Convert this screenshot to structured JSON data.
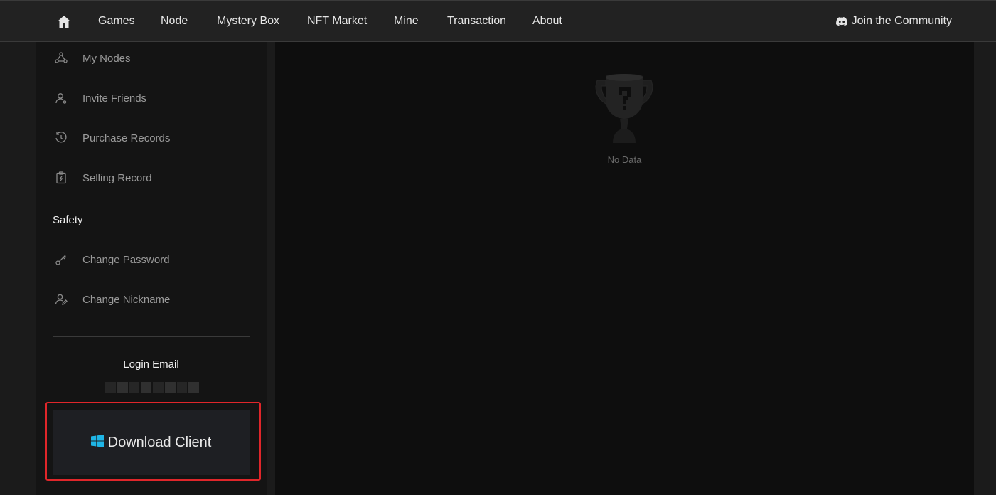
{
  "nav": {
    "items": [
      "Games",
      "Node",
      "Mystery Box",
      "NFT Market",
      "Mine",
      "Transaction",
      "About"
    ],
    "community": "Join the Community"
  },
  "sidebar": {
    "menu_top": [
      {
        "label": "My Nodes",
        "icon": "nodes-icon"
      },
      {
        "label": "Invite Friends",
        "icon": "invite-user-icon"
      },
      {
        "label": "Purchase Records",
        "icon": "history-icon"
      },
      {
        "label": "Selling Record",
        "icon": "clipboard-icon"
      }
    ],
    "safety_title": "Safety",
    "menu_safety": [
      {
        "label": "Change Password",
        "icon": "key-icon"
      },
      {
        "label": "Change Nickname",
        "icon": "user-edit-icon"
      }
    ],
    "login_email_label": "Login Email",
    "download_label": "Download Client"
  },
  "main": {
    "empty_text": "No Data"
  },
  "colors": {
    "highlight_border": "#e0262a",
    "windows_logo": "#1fb5e6"
  }
}
